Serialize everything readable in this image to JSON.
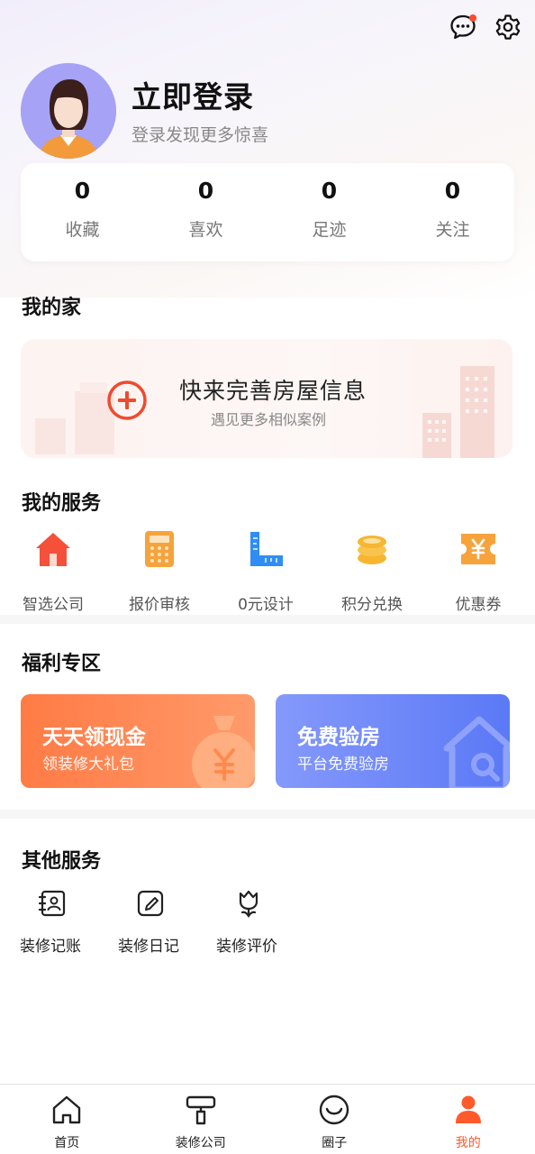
{
  "header": {
    "message_icon": "chat-bubble-icon",
    "settings_icon": "gear-icon",
    "has_notification": true
  },
  "profile": {
    "title": "立即登录",
    "subtitle": "登录发现更多惊喜"
  },
  "stats": [
    {
      "value": "0",
      "label": "收藏"
    },
    {
      "value": "0",
      "label": "喜欢"
    },
    {
      "value": "0",
      "label": "足迹"
    },
    {
      "value": "0",
      "label": "关注"
    }
  ],
  "my_home": {
    "title": "我的家",
    "main": "快来完善房屋信息",
    "sub": "遇见更多相似案例"
  },
  "my_services": {
    "title": "我的服务",
    "items": [
      {
        "label": "智选公司",
        "icon": "house-icon",
        "color": "#f4503a"
      },
      {
        "label": "报价审核",
        "icon": "calculator-icon",
        "color": "#f5a33c"
      },
      {
        "label": "0元设计",
        "icon": "ruler-icon",
        "color": "#2f8df5"
      },
      {
        "label": "积分兑换",
        "icon": "coins-icon",
        "color": "#f7b531"
      },
      {
        "label": "优惠券",
        "icon": "coupon-icon",
        "color": "#f7a33c"
      }
    ]
  },
  "welfare": {
    "title": "福利专区",
    "cards": [
      {
        "title": "天天领现金",
        "sub": "领装修大礼包"
      },
      {
        "title": "免费验房",
        "sub": "平台免费验房"
      }
    ]
  },
  "other_services": {
    "title": "其他服务",
    "items": [
      {
        "label": "装修记账",
        "icon": "ledger-icon"
      },
      {
        "label": "装修日记",
        "icon": "edit-note-icon"
      },
      {
        "label": "装修评价",
        "icon": "tulip-icon"
      }
    ]
  },
  "tabbar": [
    {
      "label": "首页",
      "icon": "home-outline-icon"
    },
    {
      "label": "装修公司",
      "icon": "paint-roller-icon"
    },
    {
      "label": "圈子",
      "icon": "smile-circle-icon"
    },
    {
      "label": "我的",
      "icon": "person-icon",
      "active": true
    }
  ],
  "colors": {
    "accent": "#ff5a2c",
    "welfare_left": "#ff7b45",
    "welfare_right": "#5b79f6"
  }
}
